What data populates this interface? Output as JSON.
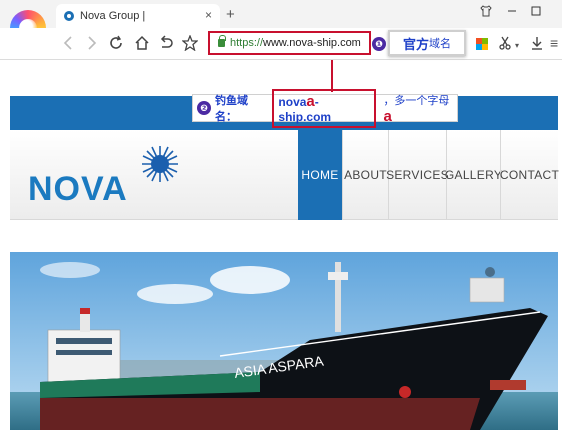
{
  "browser": {
    "tab_title": "Nova Group |",
    "tab_close": "×",
    "new_tab": "+",
    "address_scheme": "https://",
    "address_rest": "www.nova-ship.com"
  },
  "annotations": {
    "badge_1": "❶",
    "official_big": "官方",
    "official_small": "域名",
    "badge_2": "❷",
    "phish_label": "钓鱼域名：",
    "phish_domain_pre": "nova",
    "phish_domain_accent": "a",
    "phish_domain_post": "-ship.com",
    "phish_note": "，多一个字母",
    "phish_note_accent": "a"
  },
  "site": {
    "logo": "NOVA",
    "menu": [
      {
        "label": "HOME",
        "active": true
      },
      {
        "label": "ABOUT",
        "active": false
      },
      {
        "label": "SERVICES",
        "active": false
      },
      {
        "label": "GALLERY",
        "active": false
      },
      {
        "label": "CONTACT",
        "active": false
      }
    ],
    "ship_name": "ASIA ASPARA"
  },
  "colors": {
    "brand_blue": "#1b6fb4",
    "highlight_red": "#c8102e",
    "annotation_blue": "#1e40c8"
  }
}
